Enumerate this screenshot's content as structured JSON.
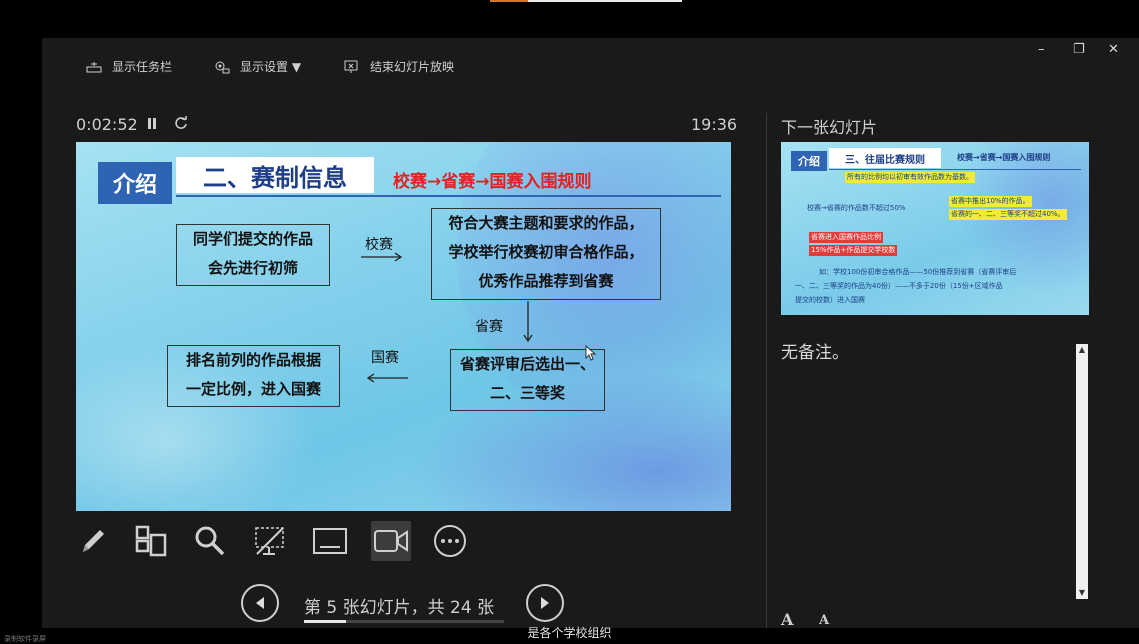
{
  "toolbar": {
    "show_taskbar": "显示任务栏",
    "display_settings": "显示设置 ▼",
    "end_show": "结束幻灯片放映"
  },
  "window_controls": {
    "minimize": "–",
    "restore": "❐",
    "close": "✕"
  },
  "presenter": {
    "elapsed": "0:02:52",
    "clock": "19:36",
    "next_slide_label": "下一张幻灯片",
    "notes": "无备注。",
    "page_text": "第 5 张幻灯片，共 24 张",
    "current_slide": 5,
    "total_slides": 24,
    "font_increase": "A",
    "font_decrease": "A"
  },
  "slide": {
    "intro": "介绍",
    "title": "二、赛制信息",
    "rule_title": "校赛→省赛→国赛入围规则",
    "box1": [
      "同学们提交的作品",
      "会先进行初筛"
    ],
    "box2": [
      "符合大赛主题和要求的作品，",
      "学校举行校赛初审合格作品，",
      "优秀作品推荐到省赛"
    ],
    "box3": [
      "省赛评审后选出一、",
      "二、三等奖"
    ],
    "box4": [
      "排名前列的作品根据",
      "一定比例，进入国赛"
    ],
    "label_school": "校赛",
    "label_province": "省赛",
    "label_national": "国赛"
  },
  "next_slide": {
    "intro": "介绍",
    "title": "三、往届比赛规则",
    "rule_title": "校赛→省赛→国赛入围规则",
    "note_yellow1": "所有的比例均以初审有效作品数为基数。",
    "line_school": "校赛→省赛的作品数不超过50%",
    "note_yellow2": "省赛中推出10%的作品。",
    "note_yellow3": "省赛的一、二、三等奖不超过40%。",
    "note_red1": "省赛进入国赛作品比例",
    "note_red2": "15%作品+作品提交学校数",
    "example1": "如：学校100份初审合格作品——50份推荐到省赛（省赛评审后",
    "example2": "一、二、三等奖的作品为40份）——不多于20份（15份+区域作品",
    "example3": "提交的校数）进入国赛"
  },
  "subtitle": "是各个学校组织",
  "corner_text": "录制软件录屏"
}
